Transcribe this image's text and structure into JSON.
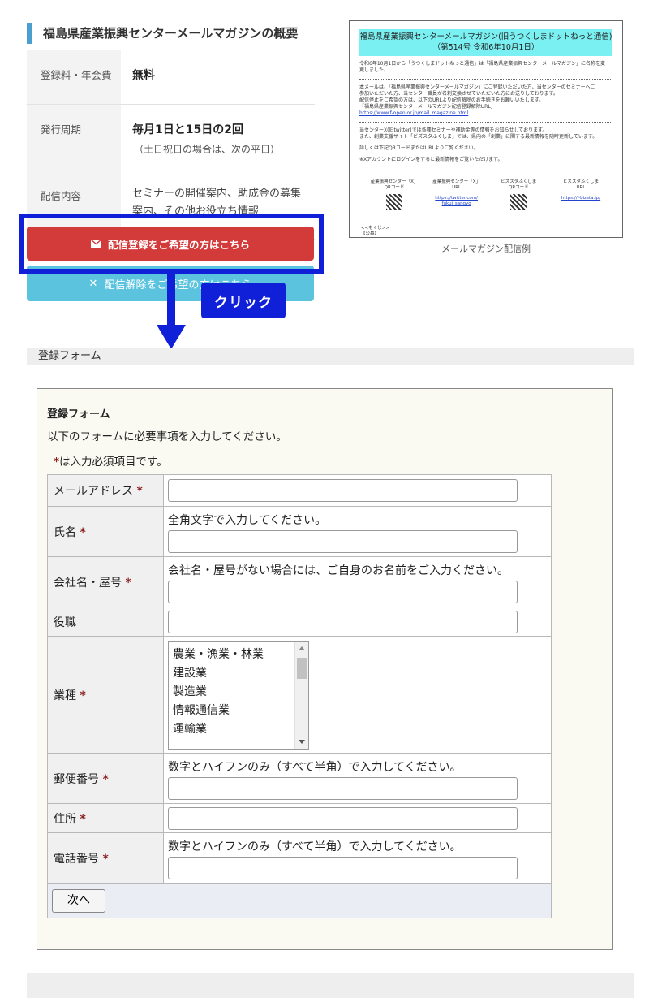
{
  "overview": {
    "title": "福島県産業振興センターメールマガジンの概要",
    "rows": [
      {
        "label": "登録料・年会費",
        "value": "無料"
      },
      {
        "label": "発行周期",
        "value": "毎月1日と15日の2回",
        "note": "（土日祝日の場合は、次の平日）"
      },
      {
        "label": "配信内容",
        "value_line1": "セミナーの開催案内、助成金の募集",
        "value_line2": "案内、その他お役立ち情報"
      }
    ]
  },
  "buttons": {
    "register": "配信登録をご希望の方はこちら",
    "unregister": "配信解除をご希望の方はこちら"
  },
  "annotation": {
    "click_label": "クリック"
  },
  "sample": {
    "head_line1": "福島県産業振興センターメールマガジン(旧うつくしまドットねっと通信)",
    "head_line2": "（第514号 令和6年10月1日）",
    "line1": "令和6年10月1日から「うつくしまドットねっと通信」は「福島県産業振興センターメールマガジン」に名称を変",
    "line2": "更しました。",
    "line3": "本メールは、「福島県産業振興センターメールマガジン」にご登録いただいた方、当センターのセミナーへご",
    "line4": "参加いただいた方、当センター職員が名刺交換させていただいた方にお送りしております。",
    "line5": "配信停止をご希望の方は、以下のURLより配信解除のお手続きをお願いいたします。",
    "line6": "「福島県産業振興センターメールマガジン配信登録解除URL」",
    "line7": "https://www.f-open.or.jp/mail_magazine.html",
    "line8": "当センターX(旧twitter)では各種セミナーや補助金等の情報をお知らせしております。",
    "line9": "また、創業支援サイト「ビズスタふくしま」では、県内の「創業」に関する最新情報を随時更新しています。",
    "line10": "詳しくは下記QRコードまたはURLよりご覧ください。",
    "line11": "※Xアカウントにログインをすると最新情報をご覧いただけます。",
    "qr": [
      {
        "line1": "産業振興センター「X」",
        "line2": "QRコード"
      },
      {
        "line1": "産業振興センター「X」",
        "line2": "URL",
        "url1": "https://twitter.com/",
        "url2": "fukui_sangyo"
      },
      {
        "line1": "ビズスタふくしま",
        "line2": "QRコード"
      },
      {
        "line1": "ビズスタふくしま",
        "line2": "URL",
        "url1": "https://f-bizsta.jp/"
      }
    ],
    "foot1": "<<もくじ>>",
    "foot2": "【公募】",
    "caption": "メールマガジン配信例"
  },
  "section_title": "登録フォーム",
  "form": {
    "title": "登録フォーム",
    "intro": "以下のフォームに必要事項を入力してください。",
    "required_star": "*",
    "required_note": "は入力必須項目です。",
    "fields": {
      "email": {
        "label": "メールアドレス",
        "value": ""
      },
      "name": {
        "label": "氏名",
        "hint": "全角文字で入力してください。",
        "value": ""
      },
      "company": {
        "label": "会社名・屋号",
        "hint": "会社名・屋号がない場合には、ご自身のお名前をご入力ください。",
        "value": ""
      },
      "position": {
        "label": "役職",
        "value": ""
      },
      "industry": {
        "label": "業種",
        "options": [
          "農業・漁業・林業",
          "建設業",
          "製造業",
          "情報通信業",
          "運輸業"
        ]
      },
      "postal": {
        "label": "郵便番号",
        "hint": "数字とハイフンのみ（すべて半角）で入力してください。",
        "value": ""
      },
      "address": {
        "label": "住所",
        "value": ""
      },
      "phone": {
        "label": "電話番号",
        "hint": "数字とハイフンのみ（すべて半角）で入力してください。",
        "value": ""
      }
    },
    "next_button": "次へ"
  },
  "colors": {
    "register_button": "#d33a3a",
    "unregister_button": "#5bc3de",
    "annotation_blue": "#1020d8",
    "title_accent": "#4a9fd0",
    "required_star": "#8b1e1e",
    "sample_header": "#7bf0f2"
  }
}
